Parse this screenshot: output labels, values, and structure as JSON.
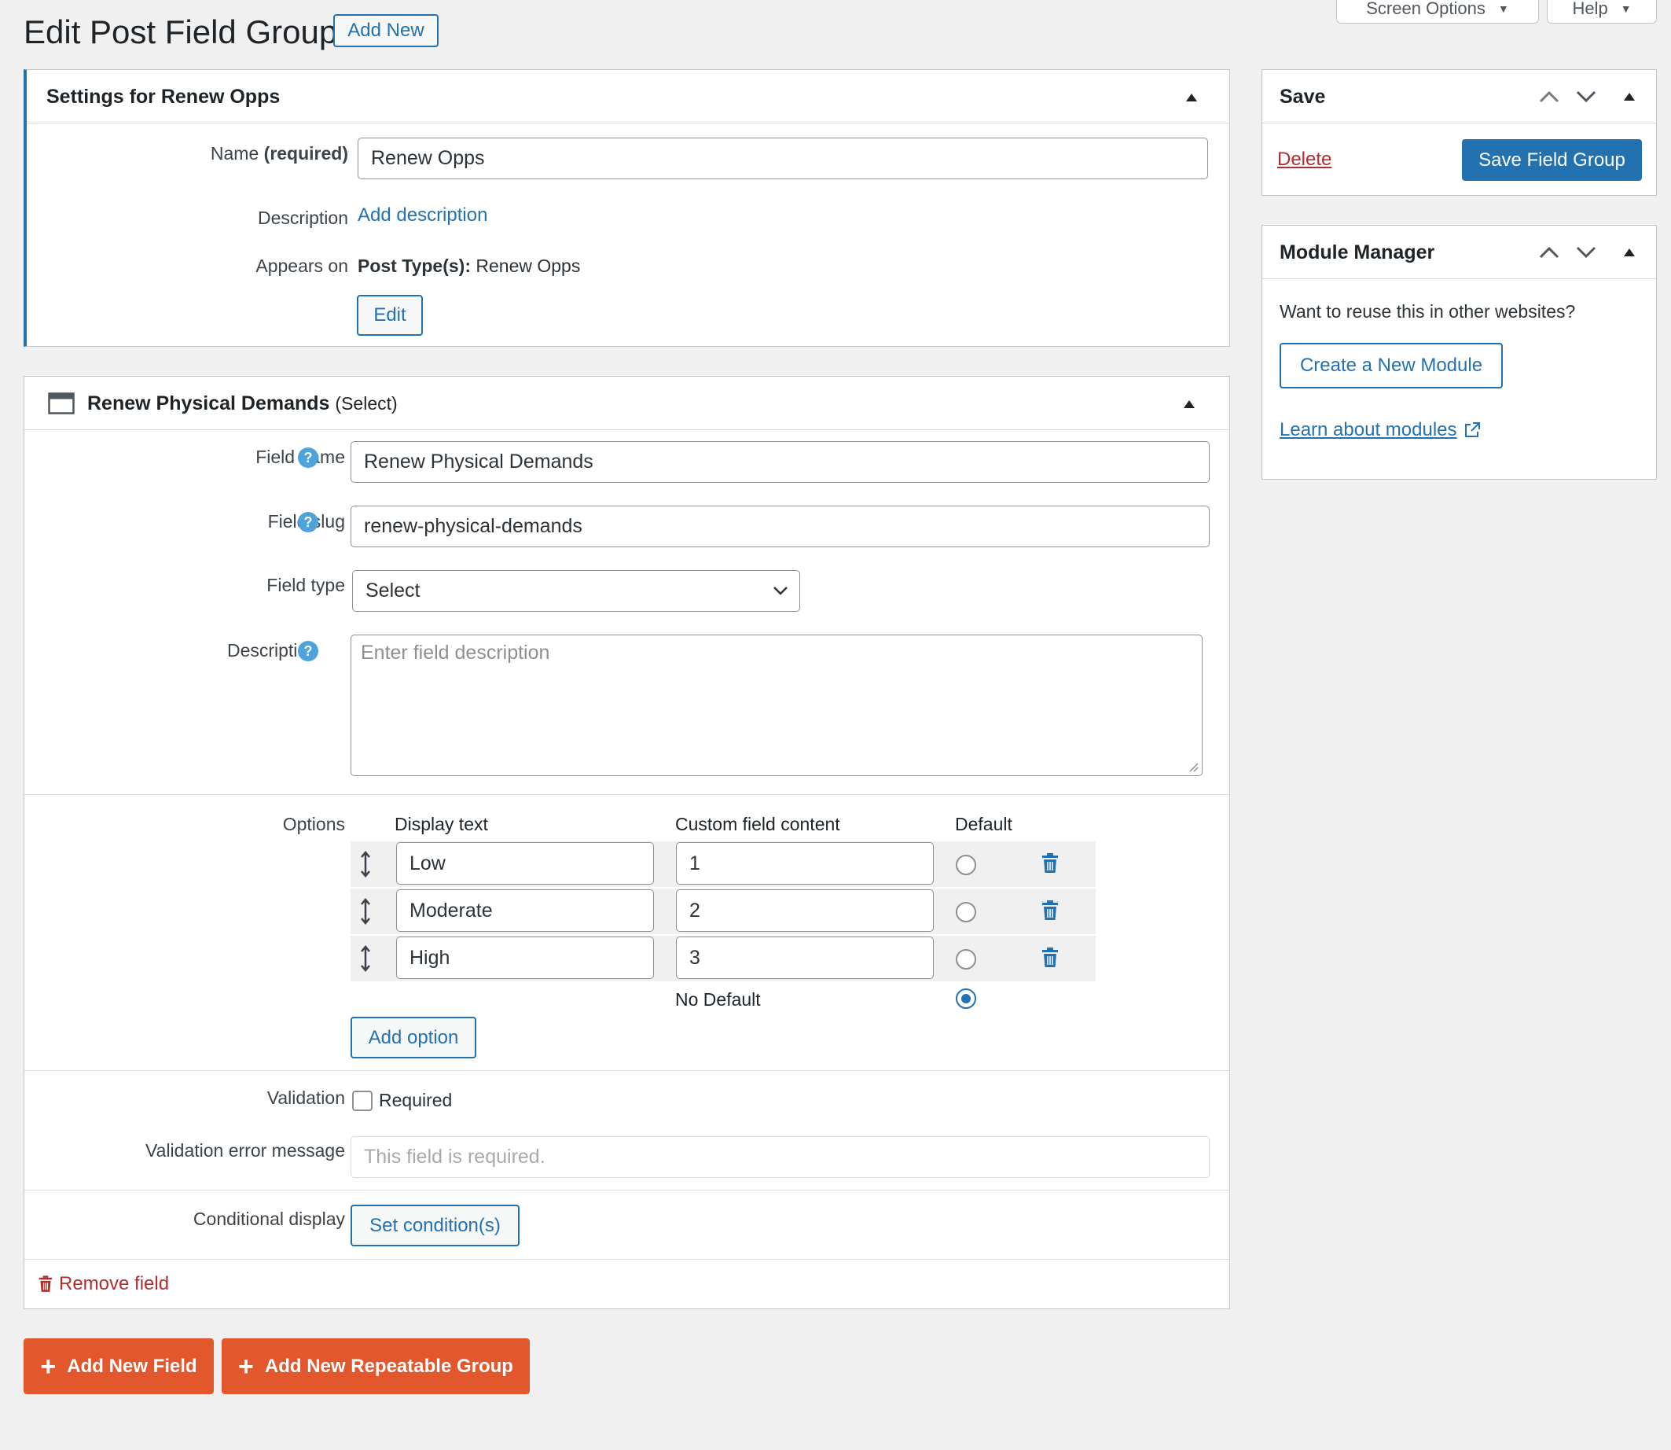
{
  "page": {
    "title": "Edit Post Field Group",
    "add_new_label": "Add New",
    "screen_options_label": "Screen Options",
    "help_label": "Help"
  },
  "settings_box": {
    "title": "Settings for Renew Opps",
    "name_label": "Name",
    "name_required": "(required)",
    "name_value": "Renew Opps",
    "description_label": "Description",
    "add_description_link": "Add description",
    "appears_on_label": "Appears on",
    "post_types_label": "Post Type(s):",
    "post_types_value": "Renew Opps",
    "edit_button": "Edit"
  },
  "field_box": {
    "title": "Renew Physical Demands",
    "type_suffix": "(Select)",
    "field_name_label": "Field name",
    "field_name_value": "Renew Physical Demands",
    "field_slug_label": "Field slug",
    "field_slug_value": "renew-physical-demands",
    "field_type_label": "Field type",
    "field_type_value": "Select",
    "description_label": "Description",
    "description_placeholder": "Enter field description",
    "options_label": "Options",
    "col_display_text": "Display text",
    "col_custom_content": "Custom field content",
    "col_default": "Default",
    "options": [
      {
        "display": "Low",
        "value": "1"
      },
      {
        "display": "Moderate",
        "value": "2"
      },
      {
        "display": "High",
        "value": "3"
      }
    ],
    "no_default_label": "No Default",
    "add_option_button": "Add option",
    "validation_label": "Validation",
    "required_checkbox_label": "Required",
    "validation_error_label": "Validation error message",
    "validation_error_placeholder": "This field is required.",
    "conditional_display_label": "Conditional display",
    "set_conditions_button": "Set condition(s)",
    "remove_field_link": "Remove field"
  },
  "bottom_actions": {
    "add_new_field": "Add New Field",
    "add_repeatable_group": "Add New Repeatable Group"
  },
  "save_box": {
    "title": "Save",
    "delete_link": "Delete",
    "save_button": "Save Field Group"
  },
  "module_box": {
    "title": "Module Manager",
    "prompt": "Want to reuse this in other websites?",
    "create_button": "Create a New Module",
    "learn_link": "Learn about modules"
  },
  "colors": {
    "accent": "#2271b1",
    "danger": "#b32d2e",
    "orange": "#e3572d",
    "help_icon": "#4ea3dc"
  }
}
